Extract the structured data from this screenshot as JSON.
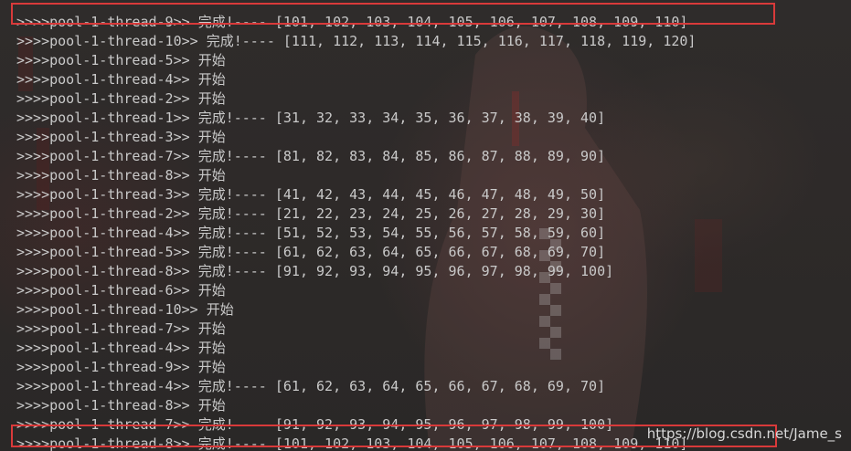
{
  "terminal": {
    "lines": [
      {
        "prefix": ">>>>",
        "thread": "pool-1-thread-9",
        "status": "完成!----",
        "values": "[101, 102, 103, 104, 105, 106, 107, 108, 109, 110]",
        "highlight": true
      },
      {
        "prefix": ">>>>",
        "thread": "pool-1-thread-10",
        "status": "完成!----",
        "values": "[111, 112, 113, 114, 115, 116, 117, 118, 119, 120]"
      },
      {
        "prefix": ">>>>",
        "thread": "pool-1-thread-5",
        "status": "开始",
        "values": ""
      },
      {
        "prefix": ">>>>",
        "thread": "pool-1-thread-4",
        "status": "开始",
        "values": ""
      },
      {
        "prefix": ">>>>",
        "thread": "pool-1-thread-2",
        "status": "开始",
        "values": ""
      },
      {
        "prefix": ">>>>",
        "thread": "pool-1-thread-1",
        "status": "完成!----",
        "values": "[31, 32, 33, 34, 35, 36, 37, 38, 39, 40]"
      },
      {
        "prefix": ">>>>",
        "thread": "pool-1-thread-3",
        "status": "开始",
        "values": ""
      },
      {
        "prefix": ">>>>",
        "thread": "pool-1-thread-7",
        "status": "完成!----",
        "values": "[81, 82, 83, 84, 85, 86, 87, 88, 89, 90]"
      },
      {
        "prefix": ">>>>",
        "thread": "pool-1-thread-8",
        "status": "开始",
        "values": ""
      },
      {
        "prefix": ">>>>",
        "thread": "pool-1-thread-3",
        "status": "完成!----",
        "values": "[41, 42, 43, 44, 45, 46, 47, 48, 49, 50]"
      },
      {
        "prefix": ">>>>",
        "thread": "pool-1-thread-2",
        "status": "完成!----",
        "values": "[21, 22, 23, 24, 25, 26, 27, 28, 29, 30]"
      },
      {
        "prefix": ">>>>",
        "thread": "pool-1-thread-4",
        "status": "完成!----",
        "values": "[51, 52, 53, 54, 55, 56, 57, 58, 59, 60]"
      },
      {
        "prefix": ">>>>",
        "thread": "pool-1-thread-5",
        "status": "完成!----",
        "values": "[61, 62, 63, 64, 65, 66, 67, 68, 69, 70]"
      },
      {
        "prefix": ">>>>",
        "thread": "pool-1-thread-8",
        "status": "完成!----",
        "values": "[91, 92, 93, 94, 95, 96, 97, 98, 99, 100]"
      },
      {
        "prefix": ">>>>",
        "thread": "pool-1-thread-6",
        "status": "开始",
        "values": ""
      },
      {
        "prefix": ">>>>",
        "thread": "pool-1-thread-10",
        "status": "开始",
        "values": ""
      },
      {
        "prefix": ">>>>",
        "thread": "pool-1-thread-7",
        "status": "开始",
        "values": ""
      },
      {
        "prefix": ">>>>",
        "thread": "pool-1-thread-4",
        "status": "开始",
        "values": ""
      },
      {
        "prefix": ">>>>",
        "thread": "pool-1-thread-9",
        "status": "开始",
        "values": ""
      },
      {
        "prefix": ">>>>",
        "thread": "pool-1-thread-4",
        "status": "完成!----",
        "values": "[61, 62, 63, 64, 65, 66, 67, 68, 69, 70]"
      },
      {
        "prefix": ">>>>",
        "thread": "pool-1-thread-8",
        "status": "开始",
        "values": ""
      },
      {
        "prefix": ">>>>",
        "thread": "pool-1-thread-7",
        "status": "完成!----",
        "values": "[91, 92, 93, 94, 95, 96, 97, 98, 99, 100]"
      },
      {
        "prefix": ">>>>",
        "thread": "pool-1-thread-8",
        "status": "完成!----",
        "values": "[101, 102, 103, 104, 105, 106, 107, 108, 109, 110]",
        "highlight": true
      }
    ],
    "colors": {
      "text": "#c9c9c9",
      "highlight_border": "#d93a3a",
      "background": "#2b2b2b"
    }
  },
  "watermark": {
    "text": "https://blog.csdn.net/Jame_s"
  }
}
